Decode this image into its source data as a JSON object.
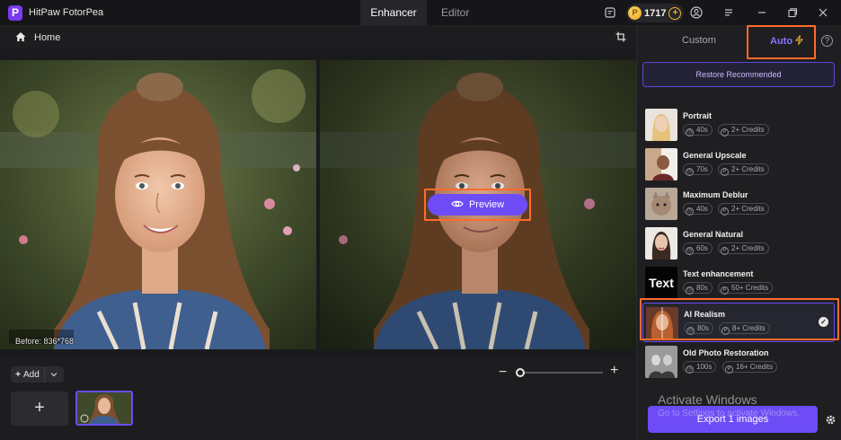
{
  "titlebar": {
    "app_name": "HitPaw FotorPea",
    "logo_letter": "P",
    "tabs": [
      {
        "label": "Enhancer",
        "active": true
      },
      {
        "label": "Editor",
        "active": false
      }
    ],
    "credits": "1717",
    "coin_symbol": "P"
  },
  "nav": {
    "home_label": "Home"
  },
  "canvas": {
    "before_label": "Before: 836*768",
    "preview_label": "Preview"
  },
  "bottom": {
    "add_label": "Add",
    "add_symbol": "+",
    "zoom_level": 0
  },
  "panel": {
    "tab_custom": "Custom",
    "tab_auto": "Auto",
    "auto_selected": true,
    "restore_label": "Restore Recommended",
    "models": [
      {
        "name": "Portrait",
        "time": "40s",
        "credits": "2+ Credits",
        "thumb_icon": "portrait-thumb",
        "selected": false
      },
      {
        "name": "General Upscale",
        "time": "70s",
        "credits": "2+ Credits",
        "thumb_icon": "upscale-thumb",
        "selected": false
      },
      {
        "name": "Maximum Deblur",
        "time": "40s",
        "credits": "2+ Credits",
        "thumb_icon": "cat-thumb",
        "selected": false
      },
      {
        "name": "General Natural",
        "time": "60s",
        "credits": "2+ Credits",
        "thumb_icon": "natural-thumb",
        "selected": false
      },
      {
        "name": "Text enhancement",
        "time": "80s",
        "credits": "50+ Credits",
        "thumb_text": "Text",
        "thumb_icon": "text-thumb",
        "selected": false
      },
      {
        "name": "AI Realism",
        "time": "80s",
        "credits": "8+ Credits",
        "thumb_icon": "realism-thumb",
        "selected": true
      },
      {
        "name": "Old Photo Restoration",
        "time": "100s",
        "credits": "16+ Credits",
        "thumb_icon": "oldphoto-thumb",
        "selected": false
      }
    ],
    "export_label": "Export 1 images",
    "watermark_line1": "Activate Windows",
    "watermark_line2": "Go to Settings to activate Windows."
  },
  "colors": {
    "accent": "#6d4cf6",
    "highlight": "#ff6b2b",
    "coin": "#f0b429"
  }
}
